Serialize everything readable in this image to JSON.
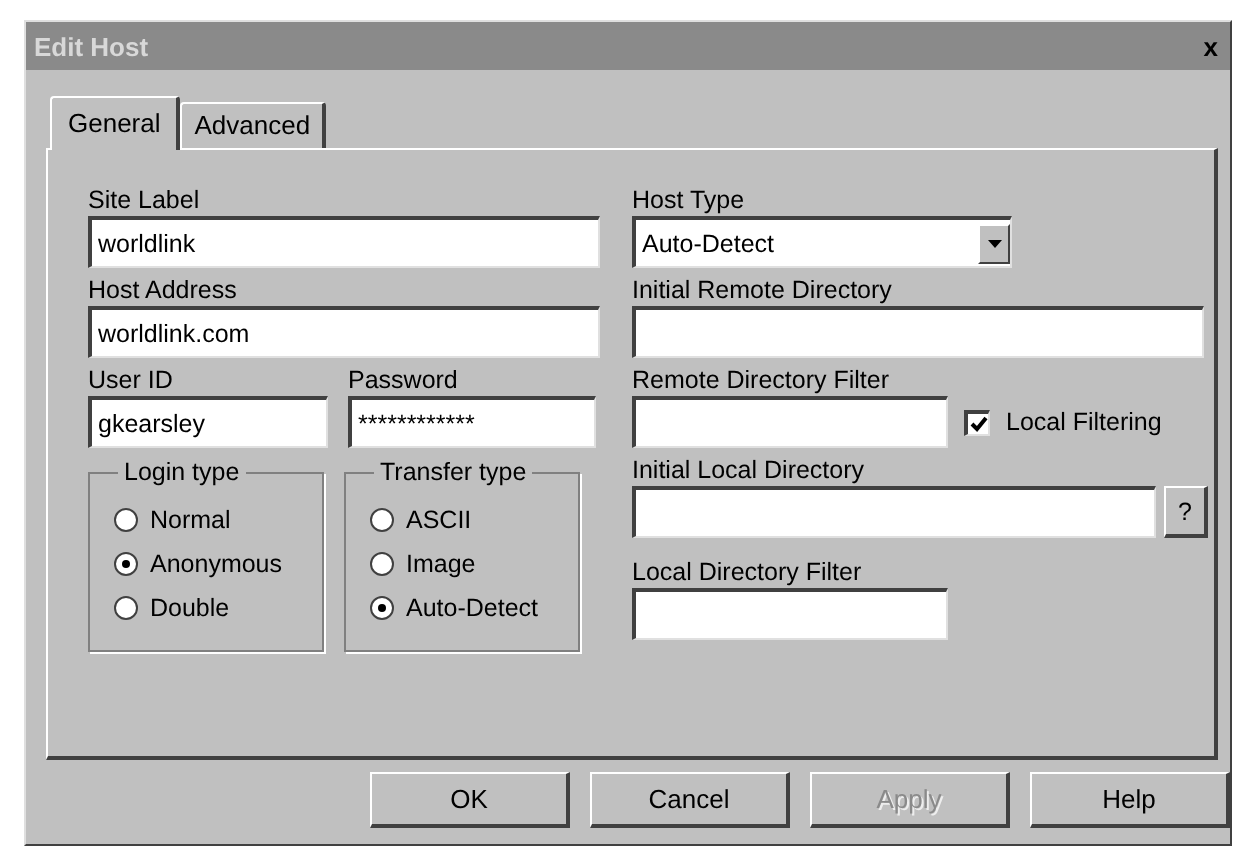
{
  "window": {
    "title": "Edit Host",
    "close": "x"
  },
  "tabs": [
    {
      "label": "General",
      "selected": true
    },
    {
      "label": "Advanced",
      "selected": false
    }
  ],
  "site_label": {
    "label": "Site Label",
    "value": "worldlink"
  },
  "host_address": {
    "label": "Host Address",
    "value": "worldlink.com"
  },
  "user_id": {
    "label": "User ID",
    "value": "gkearsley"
  },
  "password": {
    "label": "Password",
    "value": "************"
  },
  "login_type": {
    "title": "Login type",
    "options": [
      {
        "label": "Normal",
        "selected": false
      },
      {
        "label": "Anonymous",
        "selected": true
      },
      {
        "label": "Double",
        "selected": false
      }
    ]
  },
  "transfer_type": {
    "title": "Transfer type",
    "options": [
      {
        "label": "ASCII",
        "selected": false
      },
      {
        "label": "Image",
        "selected": false
      },
      {
        "label": "Auto-Detect",
        "selected": true
      }
    ]
  },
  "host_type": {
    "label": "Host Type",
    "value": "Auto-Detect"
  },
  "initial_remote_directory": {
    "label": "Initial Remote Directory"
  },
  "remote_directory_filter": {
    "label": "Remote Directory Filter"
  },
  "local_filtering": {
    "label": "Local Filtering",
    "checked": true
  },
  "initial_local_directory": {
    "label": "Initial Local Directory",
    "button": "?"
  },
  "local_directory_filter": {
    "label": "Local Directory Filter"
  },
  "buttons": [
    {
      "label": "OK",
      "disabled": false
    },
    {
      "label": "Cancel",
      "disabled": false
    },
    {
      "label": "Apply",
      "disabled": true
    },
    {
      "label": "Help",
      "disabled": false
    }
  ]
}
